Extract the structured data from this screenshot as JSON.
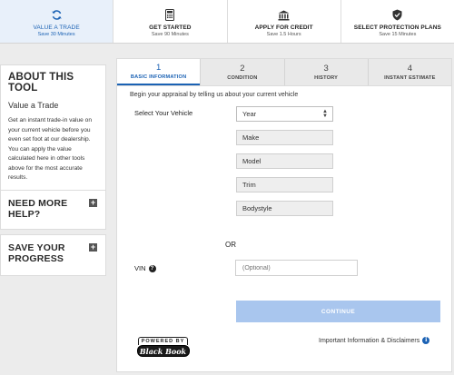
{
  "top_steps": [
    {
      "label": "VALUE A TRADE",
      "sub": "Save 30 Minutes",
      "icon": "refresh-icon",
      "active": true
    },
    {
      "label": "GET STARTED",
      "sub": "Save 90 Minutes",
      "icon": "calculator-icon",
      "active": false
    },
    {
      "label": "APPLY FOR CREDIT",
      "sub": "Save 1.5 Hours",
      "icon": "bank-icon",
      "active": false
    },
    {
      "label": "SELECT PROTECTION PLANS",
      "sub": "Save 15 Minutes",
      "icon": "shield-check-icon",
      "active": false
    }
  ],
  "sidebar": {
    "about_title": "ABOUT THIS TOOL",
    "about_subtitle": "Value a Trade",
    "about_text": "Get an instant trade-in value on your current vehicle before you even set foot at our dealership. You can apply the value calculated here in other tools above for the most accurate results.",
    "help_title": "NEED MORE HELP?",
    "save_title": "SAVE YOUR PROGRESS",
    "expand_symbol": "+"
  },
  "tabs": [
    {
      "num": "1",
      "name": "BASIC INFORMATION",
      "active": true
    },
    {
      "num": "2",
      "name": "CONDITION",
      "active": false
    },
    {
      "num": "3",
      "name": "HISTORY",
      "active": false
    },
    {
      "num": "4",
      "name": "INSTANT ESTIMATE",
      "active": false
    }
  ],
  "form": {
    "intro": "Begin your appraisal by telling us about your current vehicle",
    "select_label": "Select Your Vehicle",
    "year": "Year",
    "make": "Make",
    "model": "Model",
    "trim": "Trim",
    "bodystyle": "Bodystyle",
    "or": "OR",
    "vin_label": "VIN",
    "vin_help": "?",
    "vin_placeholder": "(Optional)",
    "continue": "CONTINUE"
  },
  "footer": {
    "powered_by": "POWERED BY",
    "brand": "Black Book",
    "disclaimer": "Important Information & Disclaimers",
    "info_symbol": "i"
  },
  "colors": {
    "accent": "#1b62b4",
    "continue_disabled": "#a9c6ee",
    "background": "#ececec"
  }
}
